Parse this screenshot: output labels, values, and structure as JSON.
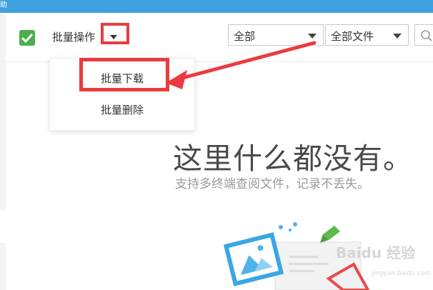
{
  "window": {
    "title_fragment": "助"
  },
  "toolbar": {
    "batch_label": "批量操作",
    "filter_scope": "全部",
    "filter_type": "全部文件"
  },
  "menu": {
    "items": [
      {
        "label": "批量下载"
      },
      {
        "label": "批量删除"
      }
    ]
  },
  "empty_state": {
    "title": "这里什么都没有。",
    "subtitle": "支持多终端查阅文件，记录不丢失。"
  },
  "watermark": {
    "text": "Baidu 经验",
    "sub": "jingyan.baidu.com"
  },
  "colors": {
    "topbar": "#3fa2e0",
    "checkbox": "#4cae4c",
    "annotation": "#ea3b3f"
  },
  "icons": [
    "checkmark-icon",
    "caret-down-icon",
    "search-icon",
    "annotation-arrow",
    "empty-illustration"
  ]
}
